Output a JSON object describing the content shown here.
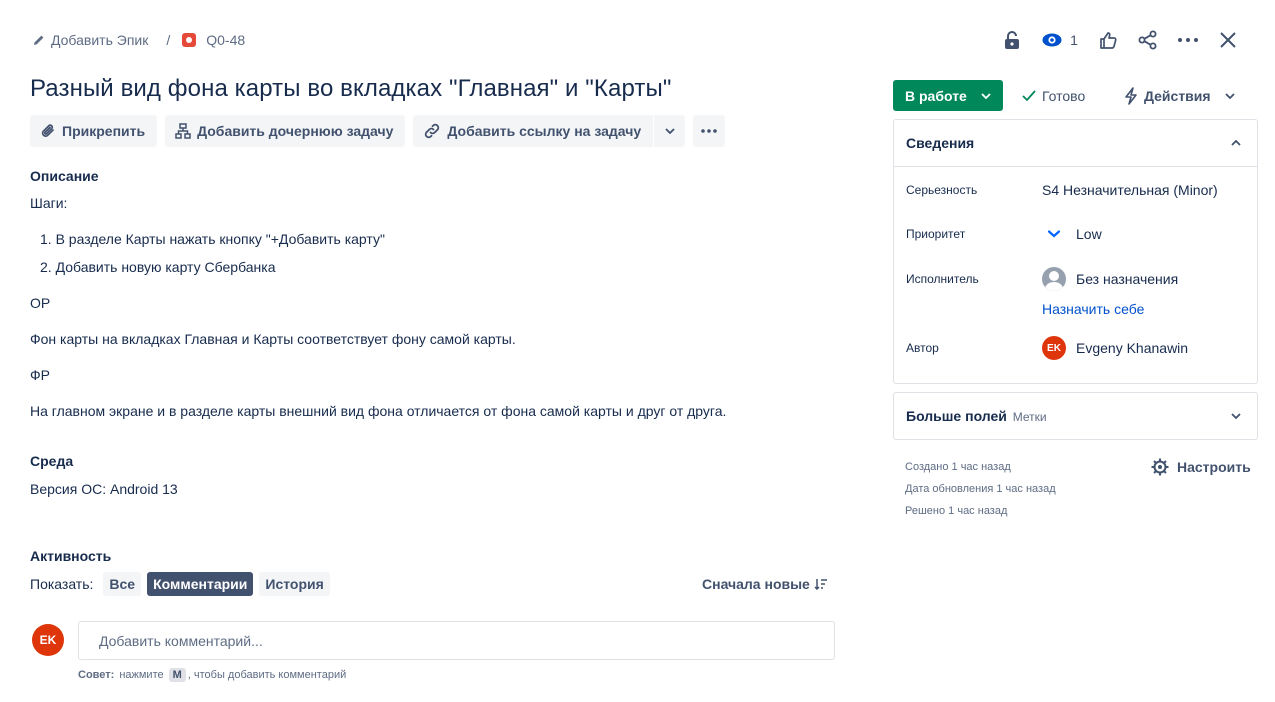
{
  "breadcrumb": {
    "add_epic": "Добавить Эпик",
    "separator": "/",
    "issue_key": "Q0-48"
  },
  "top_actions": {
    "watch_count": "1"
  },
  "issue": {
    "title": "Разный вид фона карты во вкладках \"Главная\" и \"Карты\""
  },
  "toolbar": {
    "attach": "Прикрепить",
    "add_child": "Добавить дочернюю задачу",
    "add_link": "Добавить ссылку на задачу"
  },
  "description": {
    "heading": "Описание",
    "steps_label": "Шаги:",
    "steps": [
      "1. В разделе Карты нажать кнопку \"+Добавить карту\"",
      "2. Добавить новую карту Сбербанка"
    ],
    "expected_label": "ОР",
    "expected": "Фон карты на вкладках Главная и Карты соответствует фону самой карты.",
    "actual_label": "ФР",
    "actual": "На главном экране и в разделе карты внешний вид фона отличается от фона самой карты и друг от друга."
  },
  "environment": {
    "heading": "Среда",
    "value": "Версия ОС: Android 13"
  },
  "activity": {
    "heading": "Активность",
    "show_label": "Показать:",
    "filters": [
      "Все",
      "Комментарии",
      "История"
    ],
    "active_filter": "Комментарии",
    "sort_label": "Сначала новые",
    "user_initials": "EK",
    "comment_placeholder": "Добавить комментарий...",
    "tip_bold": "Совет:",
    "tip_pre": "нажмите",
    "tip_key": "M",
    "tip_post": ", чтобы добавить комментарий"
  },
  "status": {
    "current": "В работе",
    "done": "Готово",
    "actions": "Действия"
  },
  "details": {
    "heading": "Сведения",
    "severity_label": "Серьезность",
    "severity_value": "S4 Незначительная (Minor)",
    "priority_label": "Приоритет",
    "priority_value": "Low",
    "assignee_label": "Исполнитель",
    "assignee_value": "Без назначения",
    "assign_to_me": "Назначить себе",
    "reporter_label": "Автор",
    "reporter_initials": "EK",
    "reporter_value": "Evgeny Khanawin"
  },
  "more_fields": {
    "heading": "Больше полей",
    "sub": "Метки"
  },
  "meta": {
    "created": "Создано 1 час назад",
    "updated": "Дата обновления 1 час назад",
    "resolved": "Решено 1 час назад",
    "configure": "Настроить"
  },
  "colors": {
    "status_green": "#00875a",
    "bug_red": "#e5493a",
    "avatar_red": "#de350b",
    "link_blue": "#0052cc",
    "text": "#172b4d"
  }
}
